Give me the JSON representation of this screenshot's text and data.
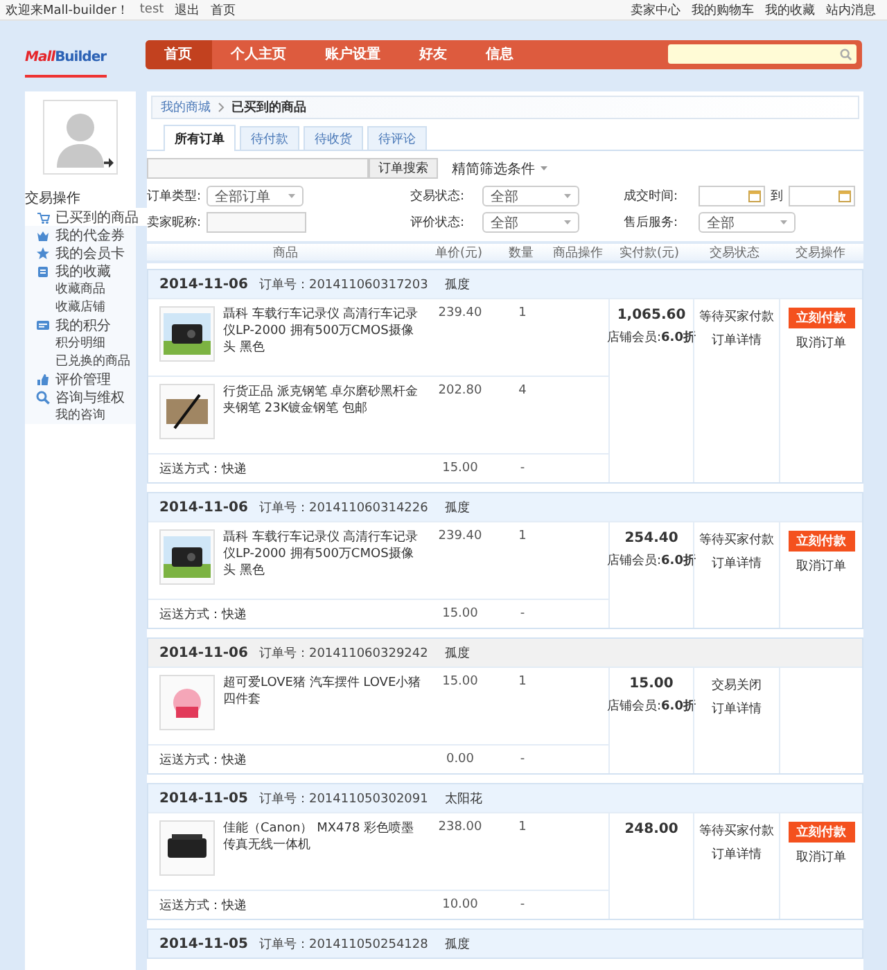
{
  "top_bar": {
    "welcome": "欢迎来Mall-builder！",
    "user": "test",
    "logout": "退出",
    "home": "首页",
    "links": [
      "卖家中心",
      "我的购物车",
      "我的收藏",
      "站内消息"
    ]
  },
  "header": {
    "logo": [
      "Mall",
      "Builder"
    ],
    "nav": [
      {
        "label": "首页",
        "selected": true
      },
      {
        "label": "个人主页",
        "selected": false
      },
      {
        "label": "账户设置",
        "selected": false
      },
      {
        "label": "好友",
        "selected": false
      },
      {
        "label": "信息",
        "selected": false
      }
    ]
  },
  "sidebar": {
    "title": "交易操作",
    "items": [
      {
        "label": "已买到的商品",
        "selected": true
      },
      {
        "label": "我的代金券",
        "selected": false
      },
      {
        "label": "我的会员卡",
        "selected": false
      },
      {
        "label": "我的收藏",
        "selected": false,
        "children": [
          {
            "label": "收藏商品"
          },
          {
            "label": "收藏店铺"
          }
        ]
      },
      {
        "label": "我的积分",
        "selected": false,
        "children": [
          {
            "label": "积分明细"
          },
          {
            "label": "已兑换的商品"
          }
        ]
      },
      {
        "label": "评价管理",
        "selected": false
      },
      {
        "label": "咨询与维权",
        "selected": false,
        "children": [
          {
            "label": "我的咨询"
          }
        ]
      }
    ]
  },
  "breadcrumb": [
    "我的商城",
    "已买到的商品"
  ],
  "tabs": [
    {
      "label": "所有订单",
      "selected": true
    },
    {
      "label": "待付款",
      "selected": false
    },
    {
      "label": "待收货",
      "selected": false
    },
    {
      "label": "待评论",
      "selected": false
    }
  ],
  "search": {
    "button": "订单搜索",
    "toggle": "精简筛选条件"
  },
  "filters": [
    {
      "kind": "select",
      "label": "订单类型:",
      "value": "全部订单"
    },
    {
      "kind": "select",
      "label": "交易状态:",
      "value": "全部"
    },
    {
      "kind": "daterange",
      "label": "成交时间:",
      "separator": "到"
    },
    {
      "kind": "text",
      "label": "卖家昵称:"
    },
    {
      "kind": "select",
      "label": "评价状态:",
      "value": "全部"
    },
    {
      "kind": "select",
      "label": "售后服务:",
      "value": "全部"
    }
  ],
  "columns": [
    "商品",
    "单价(元)",
    "数量",
    "商品操作",
    "实付款(元)",
    "交易状态",
    "交易操作"
  ],
  "orders": [
    {
      "date": "2014-11-06",
      "order_no": "订单号：201411060317203",
      "seller": "孤度",
      "closed": false,
      "items": [
        {
          "name": "聶科 车载行车记录仪 高清行车记录仪LP-2000 拥有500万CMOS摄像头 黑色",
          "price": "239.40",
          "qty": "1"
        },
        {
          "name": "行货正品 派克钢笔 卓尔磨砂黑杆金夹钢笔 23K镀金钢笔 包邮",
          "price": "202.80",
          "qty": "4"
        }
      ],
      "shipping": {
        "method": "运送方式：快递",
        "fee": "15.00",
        "qty": "-"
      },
      "total": "1,065.60",
      "discount": "店铺会员:**6.0折**",
      "status": [
        "等待买家付款",
        "订单详情"
      ],
      "actions": {
        "pay": "立刻付款",
        "cancel": "取消订单"
      }
    },
    {
      "date": "2014-11-06",
      "order_no": "订单号：201411060314226",
      "seller": "孤度",
      "closed": false,
      "items": [
        {
          "name": "聶科 车载行车记录仪 高清行车记录仪LP-2000 拥有500万CMOS摄像头 黑色",
          "price": "239.40",
          "qty": "1"
        }
      ],
      "shipping": {
        "method": "运送方式：快递",
        "fee": "15.00",
        "qty": "-"
      },
      "total": "254.40",
      "discount": "店铺会员:**6.0折**",
      "status": [
        "等待买家付款",
        "订单详情"
      ],
      "actions": {
        "pay": "立刻付款",
        "cancel": "取消订单"
      }
    },
    {
      "date": "2014-11-06",
      "order_no": "订单号：201411060329242",
      "seller": "孤度",
      "closed": true,
      "items": [
        {
          "name": "超可爱LOVE猪 汽车摆件 LOVE小猪四件套",
          "price": "15.00",
          "qty": "1"
        }
      ],
      "shipping": {
        "method": "运送方式：快递",
        "fee": "0.00",
        "qty": "-"
      },
      "total": "15.00",
      "discount": "店铺会员:**6.0折**",
      "status": [
        "交易关闭",
        "订单详情"
      ]
    },
    {
      "date": "2014-11-05",
      "order_no": "订单号：201411050302091",
      "seller": "太阳花",
      "closed": false,
      "items": [
        {
          "name": "佳能（Canon） MX478 彩色喷墨传真无线一体机",
          "price": "238.00",
          "qty": "1"
        }
      ],
      "shipping": {
        "method": "运送方式：快递",
        "fee": "10.00",
        "qty": "-"
      },
      "total": "248.00",
      "status": [
        "等待买家付款",
        "订单详情"
      ],
      "actions": {
        "pay": "立刻付款",
        "cancel": "取消订单"
      }
    },
    {
      "date": "2014-11-05",
      "order_no": "订单号：201411050254128",
      "seller": "孤度",
      "closed": false
    }
  ]
}
